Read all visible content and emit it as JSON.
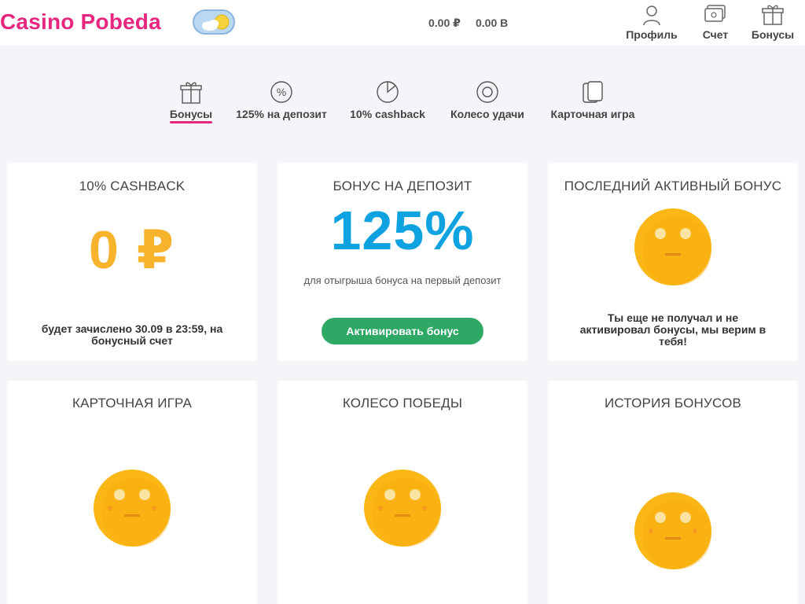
{
  "header": {
    "logo": "Casino Pobeda",
    "balance_rub": "0.00 ₽",
    "balance_b": "0.00 B",
    "items": [
      {
        "label": "Профиль",
        "icon": "user-icon"
      },
      {
        "label": "Счет",
        "icon": "wallet-icon"
      },
      {
        "label": "Бонусы",
        "icon": "gift-icon"
      }
    ]
  },
  "tabs": [
    {
      "label": "Бонусы",
      "icon": "gift-icon",
      "active": true
    },
    {
      "label": "125% на депозит",
      "icon": "percent-icon"
    },
    {
      "label": "10% cashback",
      "icon": "pie-icon"
    },
    {
      "label": "Колесо удачи",
      "icon": "wheel-icon"
    },
    {
      "label": "Карточная игра",
      "icon": "cards-icon"
    }
  ],
  "cards": {
    "cashback": {
      "title": "10% CASHBACK",
      "value": "0 ₽",
      "note": "будет зачислено 30.09 в 23:59, на бонусный счет"
    },
    "deposit": {
      "title": "БОНУС НА ДЕПОЗИТ",
      "percent": "125%",
      "subtitle": "для отыгрыша бонуса на первый депозит",
      "button": "Активировать бонус"
    },
    "last_bonus": {
      "title": "ПОСЛЕДНИЙ АКТИВНЫЙ БОНУС",
      "note": "Ты еще не получал и не активировал бонусы, мы верим в тебя!"
    },
    "card_game": {
      "title": "КАРТОЧНАЯ ИГРА"
    },
    "wheel": {
      "title": "КОЛЕСО ПОБЕДЫ"
    },
    "history": {
      "title": "ИСТОРИЯ БОНУСОВ"
    }
  },
  "colors": {
    "brand": "#e7277f",
    "cashback": "#f7b32b",
    "percent": "#0ea3e0",
    "button": "#2fa865",
    "smiley": "#fbb715"
  }
}
